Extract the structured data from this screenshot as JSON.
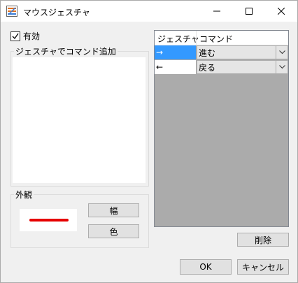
{
  "window": {
    "title": "マウスジェスチャ",
    "minimize_icon": "minimize-icon",
    "maximize_icon": "maximize-icon",
    "close_icon": "close-icon"
  },
  "enabled": {
    "label": "有効",
    "checked": true
  },
  "gesture_panel": {
    "label": "ジェスチャでコマンド追加"
  },
  "appearance": {
    "label": "外観",
    "line_color": "#e60000",
    "width_button": "幅",
    "color_button": "色"
  },
  "table": {
    "headers": [
      "ジェスチャ",
      "コマンド"
    ],
    "rows": [
      {
        "gesture": "→",
        "command": "進む",
        "selected": true
      },
      {
        "gesture": "←",
        "command": "戻る",
        "selected": false
      }
    ]
  },
  "buttons": {
    "delete": "削除",
    "ok": "OK",
    "cancel": "キャンセル"
  },
  "colors": {
    "selection": "#3399ff",
    "table_bg": "#ababab"
  }
}
